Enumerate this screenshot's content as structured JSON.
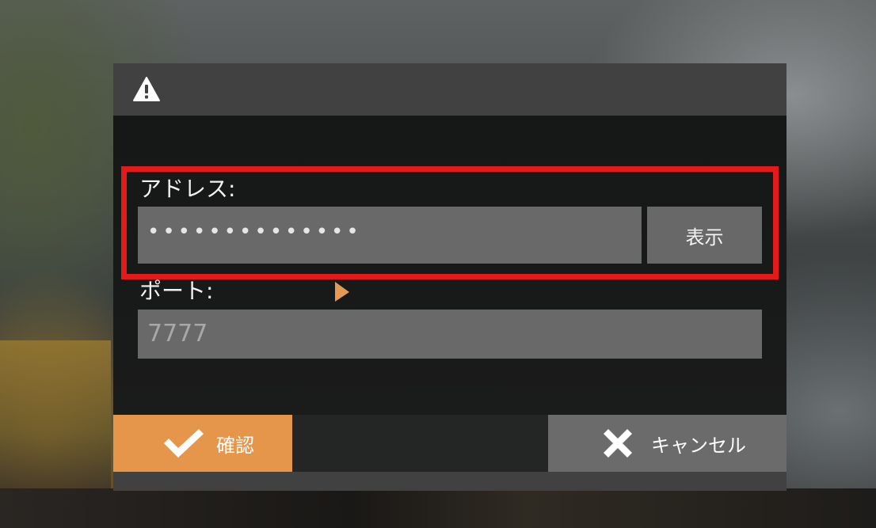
{
  "dialog": {
    "header_icon": "warning-icon",
    "address": {
      "label": "アドレス:",
      "masked_value": "••••••••••••••",
      "show_label": "表示"
    },
    "port": {
      "label": "ポート:",
      "placeholder": "7777"
    },
    "footer": {
      "confirm_label": "確認",
      "confirm_icon": "checkmark-icon",
      "cancel_label": "キャンセル",
      "cancel_icon": "close-icon"
    }
  },
  "colors": {
    "header_bg": "#414141",
    "body_bg": "#141515",
    "input_bg": "#696969",
    "highlight_border": "#e21a1a",
    "confirm_bg": "#e6964a",
    "cancel_bg": "#6b6b6b",
    "cursor": "#e39a55"
  }
}
